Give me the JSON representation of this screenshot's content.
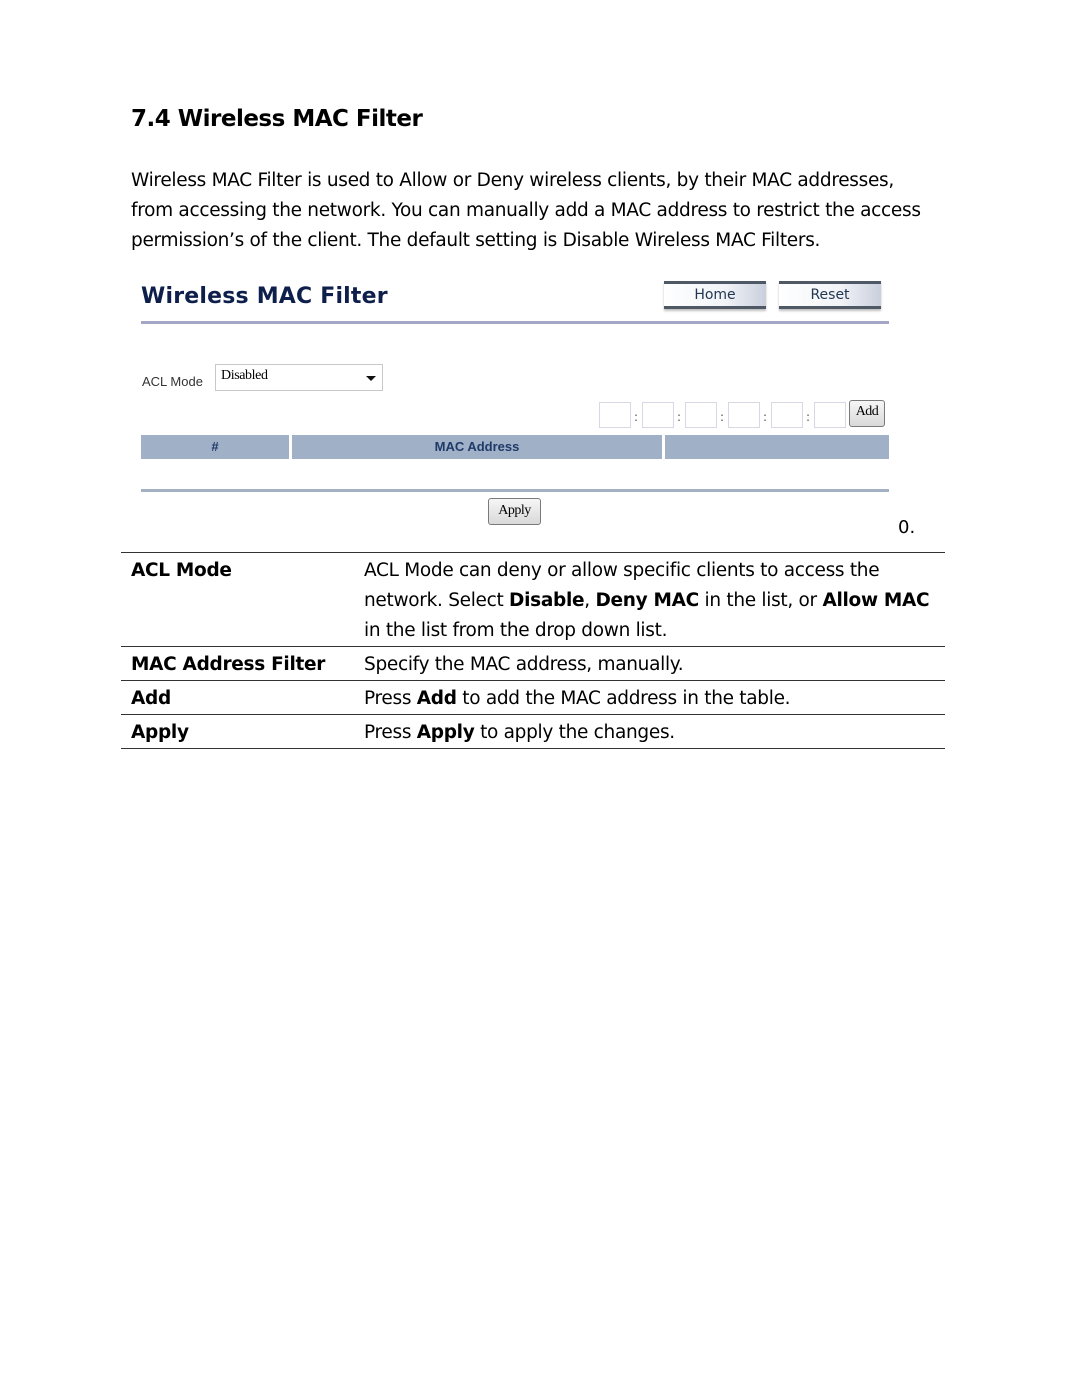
{
  "section": {
    "title": "7.4 Wireless MAC Filter",
    "intro": "Wireless MAC Filter is used to Allow or Deny wireless clients, by their MAC addresses, from accessing the network. You can manually add a MAC address to restrict the access permission’s of the client. The default setting is Disable Wireless MAC Filters."
  },
  "ui": {
    "title": "Wireless MAC Filter",
    "nav": {
      "home_label": "Home",
      "reset_label": "Reset"
    },
    "acl_mode": {
      "label": "ACL Mode",
      "selected": "Disabled"
    },
    "mac_fields": [
      "",
      "",
      "",
      "",
      "",
      ""
    ],
    "mac_separator": ":",
    "add_label": "Add",
    "table": {
      "headers": [
        "#",
        "MAC Address",
        ""
      ],
      "rows": []
    },
    "apply_label": "Apply",
    "colors": {
      "title": "#0d1f4a",
      "header_bg": "#a0b0c6",
      "header_text": "#1f3a6a",
      "rule": "#a4a6c6"
    }
  },
  "figure_number": "0.",
  "descriptions": [
    {
      "term": "ACL Mode",
      "def_parts": [
        {
          "text": "ACL Mode can deny or allow specific clients to access the network. Select ",
          "bold": false
        },
        {
          "text": "Disable",
          "bold": true
        },
        {
          "text": ", ",
          "bold": false
        },
        {
          "text": "Deny MAC",
          "bold": true
        },
        {
          "text": " in the list, or ",
          "bold": false
        },
        {
          "text": "Allow MAC",
          "bold": true
        },
        {
          "text": " in the list from the drop down list.",
          "bold": false
        }
      ]
    },
    {
      "term": "MAC Address Filter",
      "def_parts": [
        {
          "text": "Specify the MAC address, manually.",
          "bold": false
        }
      ]
    },
    {
      "term": "Add",
      "def_parts": [
        {
          "text": "Press ",
          "bold": false
        },
        {
          "text": "Add",
          "bold": true
        },
        {
          "text": " to add the MAC address in the table.",
          "bold": false
        }
      ]
    },
    {
      "term": "Apply",
      "def_parts": [
        {
          "text": "Press ",
          "bold": false
        },
        {
          "text": "Apply",
          "bold": true
        },
        {
          "text": " to apply the changes.",
          "bold": false
        }
      ]
    }
  ]
}
